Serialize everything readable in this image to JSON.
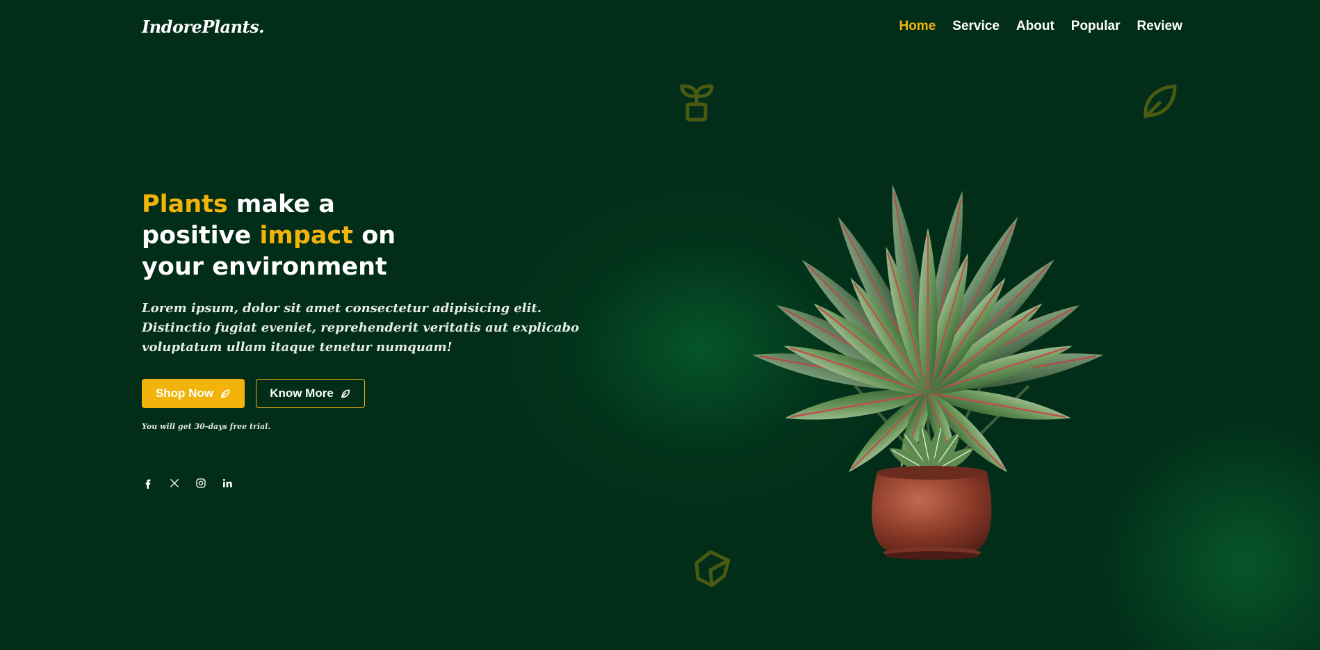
{
  "header": {
    "logo": "IndorePlants.",
    "nav": [
      {
        "label": "Home",
        "active": true
      },
      {
        "label": "Service",
        "active": false
      },
      {
        "label": "About",
        "active": false
      },
      {
        "label": "Popular",
        "active": false
      },
      {
        "label": "Review",
        "active": false
      }
    ]
  },
  "hero": {
    "title_word_1": "Plants",
    "title_text_1": " make a",
    "title_text_2": "positive ",
    "title_word_2": "impact",
    "title_text_3": " on",
    "title_text_4": "your environment",
    "description": "Lorem ipsum, dolor sit amet consectetur adipisicing elit. Distinctio fugiat eveniet, reprehenderit veritatis aut explicabo voluptatum ullam itaque tenetur numquam!",
    "primary_button": "Shop Now",
    "secondary_button": "Know More",
    "trial_note": "You will get 30-days free trial."
  },
  "social": [
    {
      "icon": "facebook-icon"
    },
    {
      "icon": "x-twitter-icon"
    },
    {
      "icon": "instagram-icon"
    },
    {
      "icon": "linkedin-icon"
    }
  ],
  "decorations": [
    "sprout-pot-icon",
    "leaf-icon",
    "leaf-badge-icon"
  ],
  "colors": {
    "background": "#022e19",
    "accent": "#f2b40b",
    "text": "#ffffff",
    "decor": "#4a5a13"
  }
}
